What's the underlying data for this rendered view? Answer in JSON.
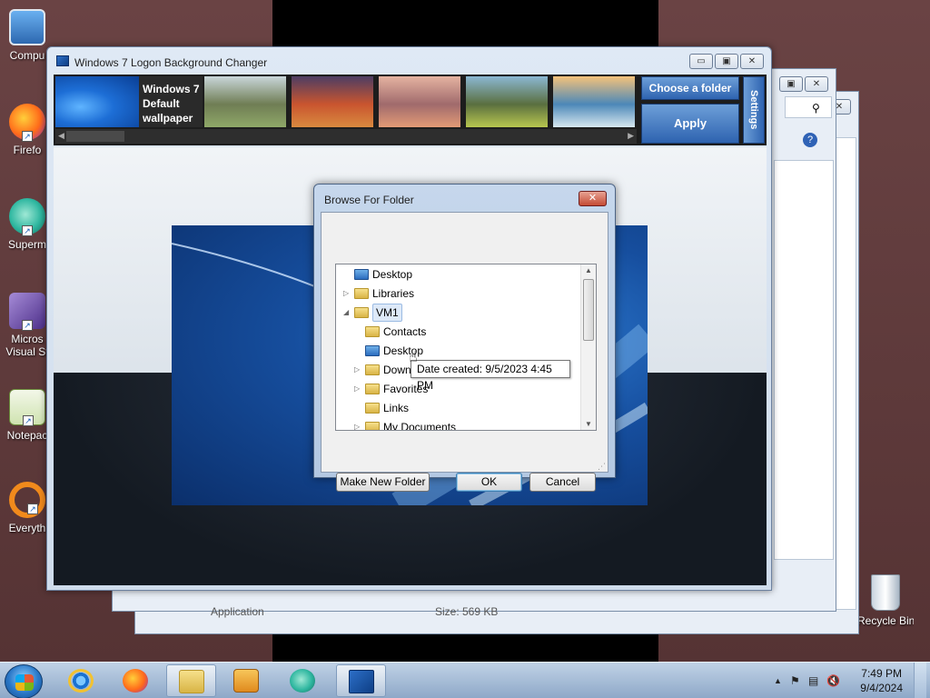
{
  "desktop": {
    "icons": [
      {
        "label": "Compu",
        "color": "#3a79c9"
      },
      {
        "label": "Firefo",
        "color": "#e8622a"
      },
      {
        "label": "Superm",
        "color": "#2fb7a0"
      },
      {
        "label": "Micros",
        "label2": "Visual St",
        "color": "#6f4ea6"
      },
      {
        "label": "Notepac",
        "color": "#5a9b3c"
      },
      {
        "label": "Everyth",
        "color": "#f18a1c"
      }
    ],
    "recycle_bin": "Recycle Bin"
  },
  "background_window": {
    "bottom_left_text": "Application",
    "bottom_right_text": "Size: 569 KB"
  },
  "app": {
    "title": "Windows 7 Logon Background Changer",
    "caption_buttons": {
      "minimize": "▭",
      "maximize": "▣",
      "close": "✕"
    },
    "default_wallpaper_caption": "Windows 7 Default wallpaper",
    "thumbnails": [
      {
        "name": "elephant",
        "colors": [
          "#c9d6da",
          "#6f7d54",
          "#8fa868"
        ]
      },
      {
        "name": "red-rocks",
        "colors": [
          "#4d3d63",
          "#c9552f",
          "#d98a3f"
        ]
      },
      {
        "name": "pink-beach",
        "colors": [
          "#e5b3a1",
          "#a06a6c",
          "#e39b76"
        ]
      },
      {
        "name": "mountain-fields",
        "colors": [
          "#8bb7d3",
          "#5a6f3f",
          "#b8c74f"
        ]
      },
      {
        "name": "waterfall-coast",
        "colors": [
          "#f5c27a",
          "#4c88b8",
          "#d7e7ef"
        ]
      }
    ],
    "choose_folder_label": "Choose a folder",
    "apply_label": "Apply",
    "settings_label": "Settings"
  },
  "dialog": {
    "title": "Browse For Folder",
    "close": "✕",
    "tree": [
      {
        "label": "Desktop",
        "indent": 0,
        "expander": "",
        "icon": "blue",
        "selected": false
      },
      {
        "label": "Libraries",
        "indent": 0,
        "expander": "▷",
        "icon": "folder",
        "selected": false
      },
      {
        "label": "VM1",
        "indent": 0,
        "expander": "◢",
        "icon": "folder",
        "selected": true
      },
      {
        "label": "Contacts",
        "indent": 1,
        "expander": "",
        "icon": "folder",
        "selected": false
      },
      {
        "label": "Desktop",
        "indent": 1,
        "expander": "",
        "icon": "blue",
        "selected": false
      },
      {
        "label": "Down",
        "indent": 1,
        "expander": "▷",
        "icon": "folder",
        "selected": false
      },
      {
        "label": "Favorites",
        "indent": 1,
        "expander": "▷",
        "icon": "folder",
        "selected": false
      },
      {
        "label": "Links",
        "indent": 1,
        "expander": "",
        "icon": "folder",
        "selected": false
      },
      {
        "label": "My Documents",
        "indent": 1,
        "expander": "▷",
        "icon": "folder",
        "selected": false
      }
    ],
    "tooltip": "Date created: 9/5/2023 4:45 PM",
    "make_new_folder": "Make New Folder",
    "ok": "OK",
    "cancel": "Cancel"
  },
  "taskbar": {
    "time": "7:49 PM",
    "date": "9/4/2024",
    "tray_arrow": "▲"
  }
}
